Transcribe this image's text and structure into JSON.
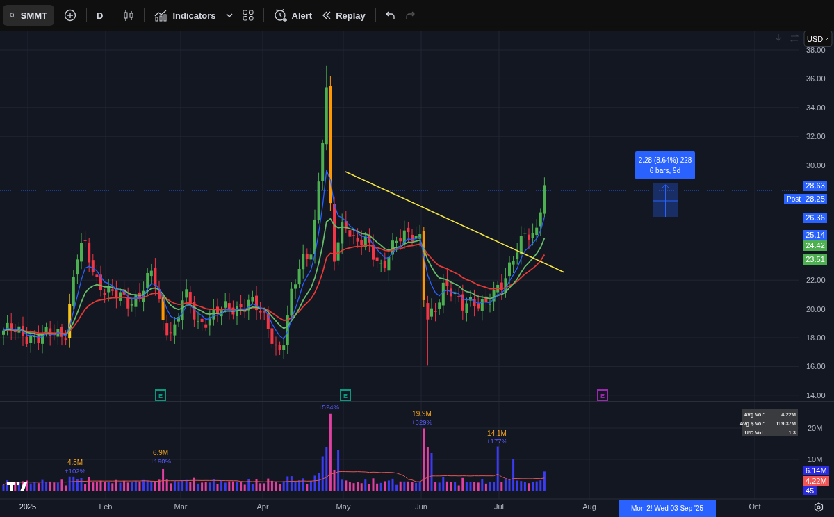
{
  "toolbar": {
    "symbol": "SMMT",
    "interval": "D",
    "indicators": "Indicators",
    "alert": "Alert",
    "replay": "Replay",
    "redo_disabled": true
  },
  "price_axis": {
    "currency": "USD",
    "ticks": [
      "38.00",
      "36.00",
      "34.00",
      "32.00",
      "30.00",
      "22.00",
      "20.00",
      "18.00",
      "16.00",
      "14.00"
    ]
  },
  "price_badges": [
    {
      "label": "28.63",
      "color": "#2962ff"
    },
    {
      "label": "28.25",
      "tag": "Post",
      "color": "#2962ff"
    },
    {
      "label": "26.36",
      "color": "#2962ff"
    },
    {
      "label": "25.14",
      "color": "#2962ff"
    },
    {
      "label": "24.42",
      "color": "#4caf50"
    },
    {
      "label": "23.51",
      "color": "#4caf50"
    }
  ],
  "measure": {
    "change": "2.28 (8.64%) 228",
    "span": "6 bars, 9d"
  },
  "earnings": [
    {
      "label": "E",
      "color": "#089981"
    },
    {
      "label": "E",
      "color": "#089981"
    },
    {
      "label": "E",
      "color": "#9c27b0"
    }
  ],
  "volume": {
    "annotations": [
      {
        "value": "4.5M",
        "change": "+102%"
      },
      {
        "value": "6.9M",
        "change": "+190%"
      },
      {
        "change": "+524%"
      },
      {
        "value": "19.9M",
        "change": "+329%"
      },
      {
        "value": "14.1M",
        "change": "+177%"
      }
    ],
    "stats": [
      {
        "label": "Avg Vol:",
        "value": "4.22M"
      },
      {
        "label": "Avg $ Vol:",
        "value": "119.37M"
      },
      {
        "label": "U/D Vol:",
        "value": "1.3"
      }
    ],
    "axis_ticks": [
      "20M",
      "10M"
    ],
    "badges": [
      {
        "label": "6.14M",
        "color": "#2a2ae0"
      },
      {
        "label": "4.22M",
        "color": "#f05454"
      },
      {
        "label": "45",
        "color": "#2a2ae0"
      }
    ]
  },
  "time_axis": {
    "labels": [
      "2025",
      "Feb",
      "Mar",
      "Apr",
      "May",
      "Jun",
      "Jul",
      "Aug",
      "Oct"
    ],
    "crosshair_label": "Mon 2!  Wed 03 Sep '25"
  }
}
